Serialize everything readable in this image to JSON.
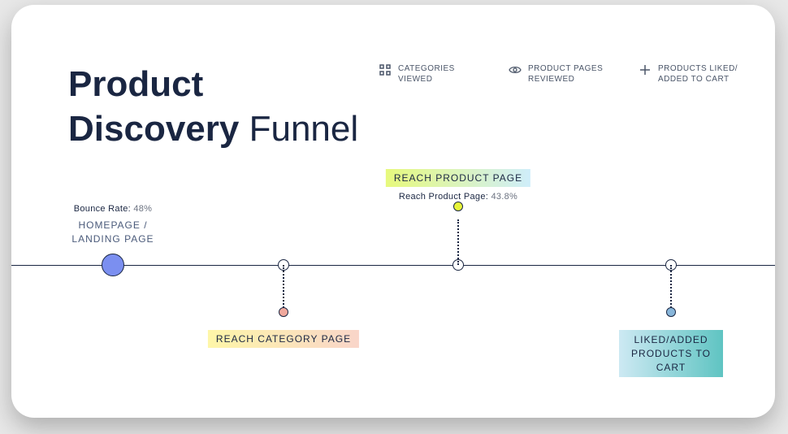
{
  "title": {
    "line1": "Product",
    "line2a": "Discovery",
    "line2b": "Funnel"
  },
  "legend": {
    "categories": "CATEGORIES VIEWED",
    "pages": "PRODUCT PAGES REVIEWED",
    "liked": "PRODUCTS LIKED/ ADDED TO CART"
  },
  "stages": {
    "home": {
      "metric_label": "Bounce Rate:",
      "metric_value": "48%",
      "label": "HOMEPAGE / LANDING PAGE"
    },
    "category": {
      "badge": "REACH CATEGORY PAGE"
    },
    "product": {
      "badge": "REACH PRODUCT PAGE",
      "metric_label": "Reach Product Page:",
      "metric_value": "43.8%"
    },
    "liked": {
      "badge": "LIKED/ADDED PRODUCTS TO CART"
    }
  }
}
